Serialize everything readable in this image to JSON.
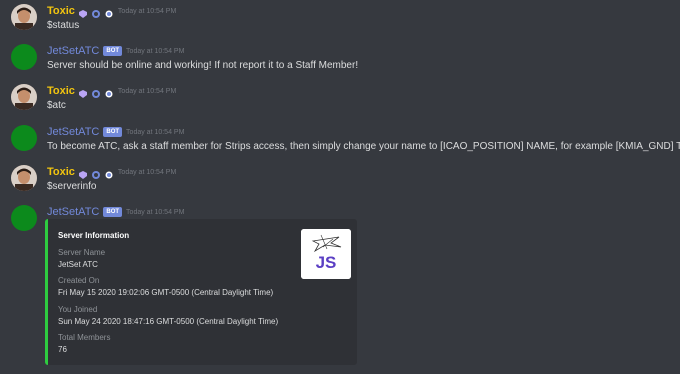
{
  "messages": [
    {
      "author": "Toxic",
      "timestamp": "Today at 10:54 PM",
      "text": "$status"
    },
    {
      "author": "JetSetATC",
      "bot_tag": "BOT",
      "timestamp": "Today at 10:54 PM",
      "text": "Server should be online and working! If not report it to a Staff Member!"
    },
    {
      "author": "Toxic",
      "timestamp": "Today at 10:54 PM",
      "text": "$atc"
    },
    {
      "author": "JetSetATC",
      "bot_tag": "BOT",
      "timestamp": "Today at 10:54 PM",
      "text": "To become ATC, ask a staff member for Strips access, then simply change your name to [ICAO_POSITION] NAME, for example [KMIA_GND] ToxicCS"
    },
    {
      "author": "Toxic",
      "timestamp": "Today at 10:54 PM",
      "text": "$serverinfo"
    },
    {
      "author": "JetSetATC",
      "bot_tag": "BOT",
      "timestamp": "Today at 10:54 PM"
    }
  ],
  "embed": {
    "title": "Server Information",
    "logo_text": "JS",
    "fields": [
      {
        "name": "Server Name",
        "value": "JetSet ATC"
      },
      {
        "name": "Created On",
        "value": "Fri May 15 2020 19:02:06 GMT-0500 (Central Daylight Time)"
      },
      {
        "name": "You Joined",
        "value": "Sun May 24 2020 18:47:16 GMT-0500 (Central Daylight Time)"
      },
      {
        "name": "Total Members",
        "value": "76"
      }
    ]
  },
  "colors": {
    "background": "#36393f",
    "user_name": "#f1c40f",
    "bot_name": "#7289da",
    "embed_accent": "#2ecc40",
    "bot_avatar": "#0c8a1c"
  }
}
